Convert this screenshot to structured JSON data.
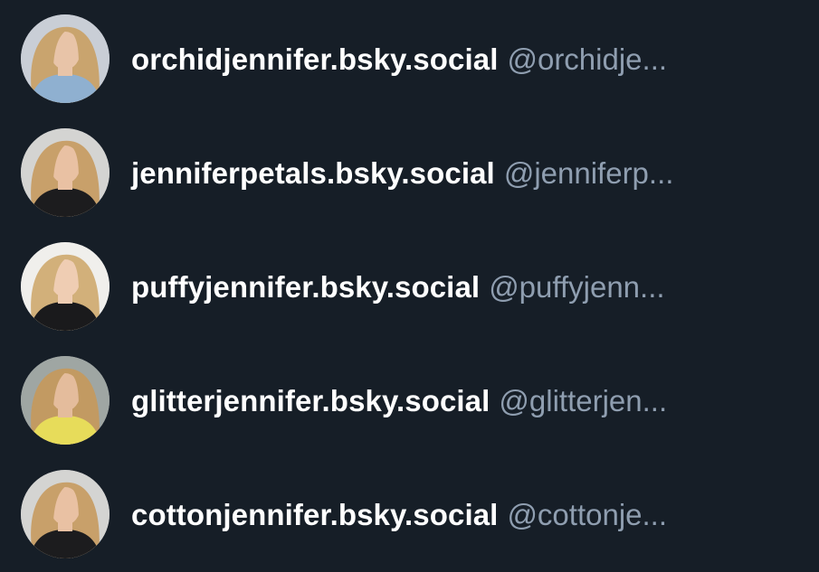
{
  "accounts": [
    {
      "display_name": "orchidjennifer.bsky.social",
      "handle": "@orchidje...",
      "avatar": {
        "hair": "#c9a46e",
        "top": "#8fb0d0",
        "bg": "#c9ced6",
        "skin": "#e8c4a8"
      }
    },
    {
      "display_name": "jenniferpetals.bsky.social",
      "handle": "@jenniferp...",
      "avatar": {
        "hair": "#c8a06a",
        "top": "#1c1c1e",
        "bg": "#d4d4d2",
        "skin": "#e9c1a3"
      }
    },
    {
      "display_name": "puffyjennifer.bsky.social",
      "handle": "@puffyjenn...",
      "avatar": {
        "hair": "#d2b07a",
        "top": "#1a1a1c",
        "bg": "#f0efec",
        "skin": "#efcdb3"
      }
    },
    {
      "display_name": "glitterjennifer.bsky.social",
      "handle": "@glitterjen...",
      "avatar": {
        "hair": "#c29a62",
        "top": "#e7dc5a",
        "bg": "#9fa6a3",
        "skin": "#e4bc9c"
      }
    },
    {
      "display_name": "cottonjennifer.bsky.social",
      "handle": "@cottonje...",
      "avatar": {
        "hair": "#c8a06a",
        "top": "#1c1c1e",
        "bg": "#d4d4d2",
        "skin": "#e9c1a3"
      }
    }
  ]
}
